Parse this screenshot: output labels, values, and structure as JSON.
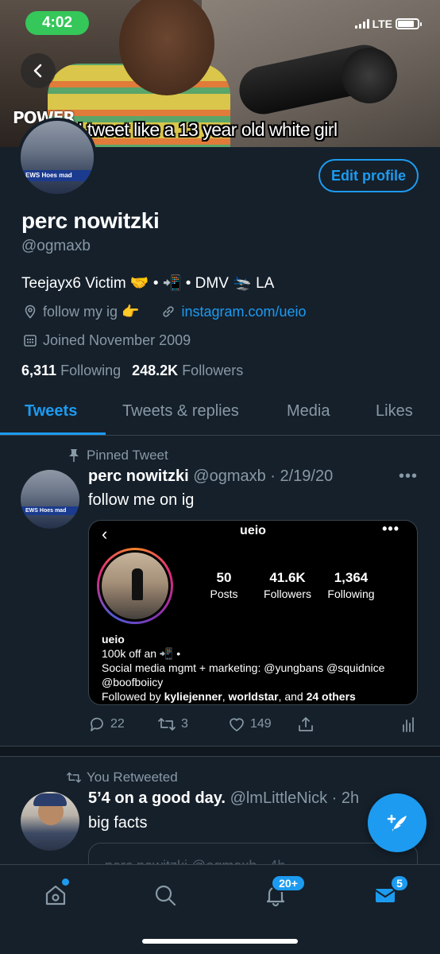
{
  "status_bar": {
    "time": "4:02",
    "network": "LTE",
    "battery_level": 0.85
  },
  "banner": {
    "brand": "POWER",
    "caption": "I tweet like a 13 year old white girl"
  },
  "avatar": {
    "ticker": "EWS   Hoes mad"
  },
  "profile": {
    "edit_label": "Edit profile",
    "display_name": "perc nowitzki",
    "handle": "@ogmaxb",
    "bio": "Teejayx6 Victim 🤝 • 📲 • DMV 🛬 LA",
    "location": "follow my ig 👉",
    "website": "instagram.com/ueio",
    "joined": "Joined November 2009",
    "following_count": "6,311",
    "following_label": "Following",
    "followers_count": "248.2K",
    "followers_label": "Followers"
  },
  "tabs": [
    "Tweets",
    "Tweets & replies",
    "Media",
    "Likes"
  ],
  "pinned_tweet": {
    "pinned_label": "Pinned Tweet",
    "name": "perc nowitzki",
    "handle_date": "@ogmaxb · 2/19/20",
    "text": "follow me on ig",
    "ig": {
      "username": "ueio",
      "posts": "50",
      "posts_label": "Posts",
      "followers": "41.6K",
      "followers_label": "Followers",
      "following": "1,364",
      "following_label": "Following",
      "name": "ueio",
      "line1": "100k off an 📲 •",
      "line2": " Social media mgmt + marketing: @yungbans @squidnice",
      "line3": "@boofboiicy",
      "followed_prefix": " Followed by ",
      "followed_users": "kyliejenner",
      "followed_sep": ", ",
      "followed_users2": "worldstar",
      "followed_and": ", and ",
      "followed_others": "24 others"
    },
    "replies": "22",
    "retweets": "3",
    "likes": "149"
  },
  "retweet": {
    "label": "You Retweeted",
    "name": "5’4 on a good day.",
    "handle_date": "@lmLittleNick · 2h",
    "text": "big facts",
    "quote_peek": "perc nowitzki @ogmaxb · 4h"
  },
  "bottom_nav": {
    "notifications_badge": "20+",
    "messages_badge": "5"
  },
  "colors": {
    "background": "#15202b",
    "accent": "#1d9bf0",
    "muted": "#8899a6",
    "border": "#38444d"
  }
}
